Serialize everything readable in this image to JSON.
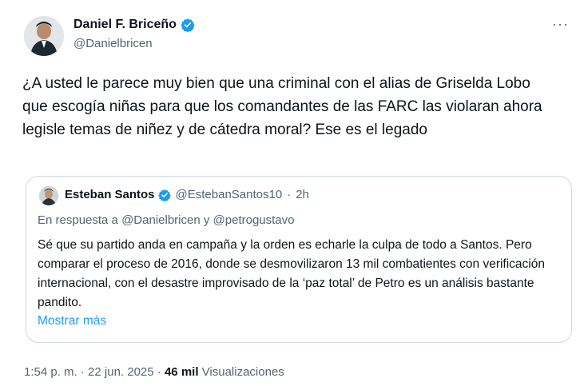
{
  "author": {
    "name": "Daniel F. Briceño",
    "handle": "@Danielbricen"
  },
  "more_menu": "···",
  "tweet_text": "¿A usted le parece muy bien que una criminal con el alias de Griselda Lobo que escogía niñas para que los comandantes de las FARC las violaran ahora legisle temas de niñez y de cátedra moral? Ese es el legado",
  "quote": {
    "name": "Esteban Santos",
    "handle": "@EstebanSantos10",
    "separator": "·",
    "time": "2h",
    "reply_prefix": "En respuesta a",
    "reply_to_1": "@Danielbricen",
    "reply_conj": "y",
    "reply_to_2": "@petrogustavo",
    "text": "Sé que su partido anda en campaña y la orden es echarle la culpa de todo a Santos. Pero comparar el proceso de 2016, donde se desmovilizaron 13 mil combatientes con verificación internacional, con el desastre improvisado de la ‘paz total’ de Petro es un análisis bastante pandito.",
    "show_more": "Mostrar más"
  },
  "meta": {
    "time": "1:54 p. m.",
    "sep1": "·",
    "date": "22 jun. 2025",
    "sep2": "·",
    "views_count": "46 mil",
    "views_label": "Visualizaciones"
  },
  "colors": {
    "verified": "#1d9bf0",
    "link": "#1d9bf0",
    "secondary_text": "#536471",
    "border": "#cfd9de"
  }
}
